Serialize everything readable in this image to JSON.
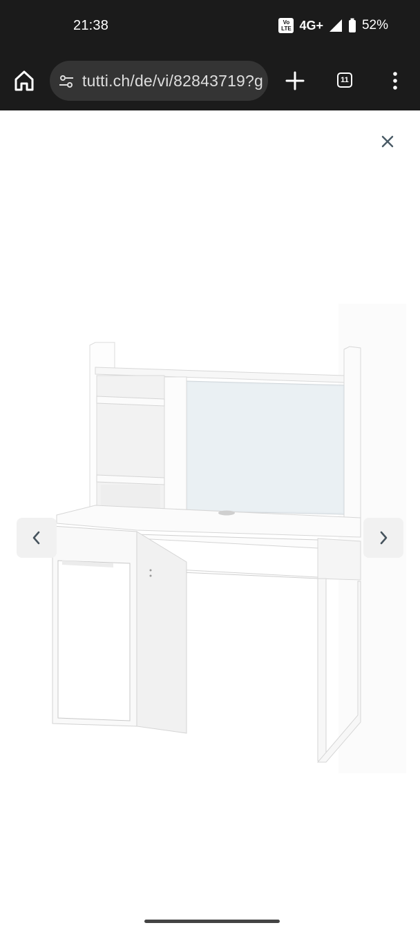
{
  "status_bar": {
    "time": "21:38",
    "volte_label": "Vo LTE",
    "network": "4G+",
    "battery": "52%",
    "icons": [
      "volte-icon",
      "signal-icon",
      "battery-icon"
    ]
  },
  "browser": {
    "url": "tutti.ch/de/vi/82843719?g",
    "tab_count": "11",
    "icons": [
      "home-icon",
      "site-settings-icon",
      "new-tab-icon",
      "tab-switcher-icon",
      "more-menu-icon"
    ]
  },
  "gallery": {
    "close_icon": "close-icon",
    "prev_icon": "chevron-left-icon",
    "next_icon": "chevron-right-icon",
    "image_subject": "white-desk-with-hutch"
  },
  "colors": {
    "status_bar_bg": "#1b1b1b",
    "url_pill_bg": "#343434",
    "close_icon": "#4a5b66",
    "arrow_bg": "#f1f1f1"
  }
}
